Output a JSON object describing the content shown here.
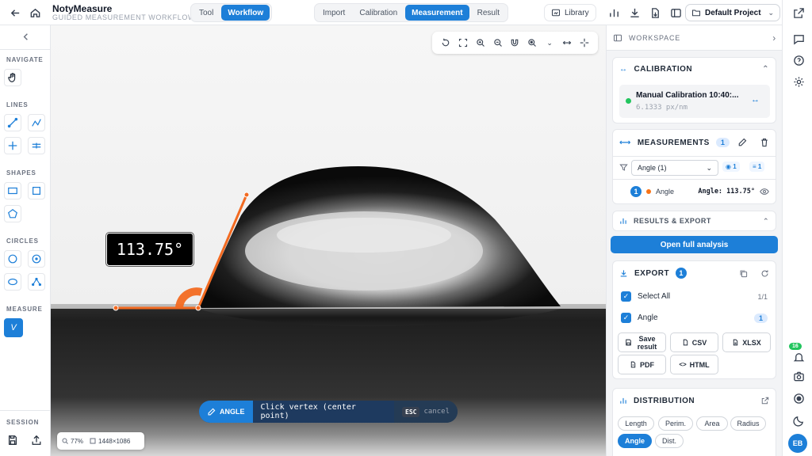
{
  "app": {
    "title": "NotyMeasure",
    "subtitle": "GUIDED MEASUREMENT WORKFLOW"
  },
  "mode_toggle": {
    "tool": "Tool",
    "workflow": "Workflow",
    "active": "Workflow"
  },
  "steps": {
    "items": [
      "Import",
      "Calibration",
      "Measurement",
      "Result"
    ],
    "active": "Measurement"
  },
  "library_label": "Library",
  "project_label": "Default Project",
  "left_sidebar": {
    "navigate": "NAVIGATE",
    "lines": "LINES",
    "shapes": "SHAPES",
    "circles": "CIRCLES",
    "measure": "MEASURE",
    "measure_active_glyph": "V",
    "session": "SESSION"
  },
  "canvas": {
    "angle_readout": "113.75°",
    "hint": {
      "mode": "ANGLE",
      "text": "Click vertex (center point)",
      "key": "ESC",
      "key_action": "cancel"
    },
    "zoom": "77%",
    "image_size": "1448×1086"
  },
  "workspace": {
    "title": "WORKSPACE",
    "calibration": {
      "title": "CALIBRATION",
      "name": "Manual Calibration 10:40:...",
      "scale": "6.1333 px/nm",
      "status_color": "#22c55e"
    },
    "measurements": {
      "title": "MEASUREMENTS",
      "count": "1",
      "filter": "Angle (1)",
      "visible_count": "1",
      "list_count": "1",
      "items": [
        {
          "index": "1",
          "type": "Angle",
          "value": "Angle: 113.75°",
          "color": "#f97316"
        }
      ]
    },
    "results": {
      "title": "RESULTS & EXPORT",
      "open_button": "Open full analysis"
    },
    "export": {
      "title": "EXPORT",
      "count": "1",
      "select_all": "Select All",
      "select_all_count": "1/1",
      "item_label": "Angle",
      "item_count": "1",
      "formats": {
        "save": "Save result",
        "csv": "CSV",
        "xlsx": "XLSX",
        "pdf": "PDF",
        "html": "HTML"
      }
    },
    "distribution": {
      "title": "DISTRIBUTION",
      "chips": [
        "Length",
        "Perim.",
        "Area",
        "Radius",
        "Angle",
        "Dist."
      ],
      "active": "Angle"
    }
  },
  "right_rail": {
    "notification_count": "16",
    "avatar_initials": "EB"
  },
  "colors": {
    "accent": "#1d7fd8",
    "measurement": "#f26a21"
  }
}
